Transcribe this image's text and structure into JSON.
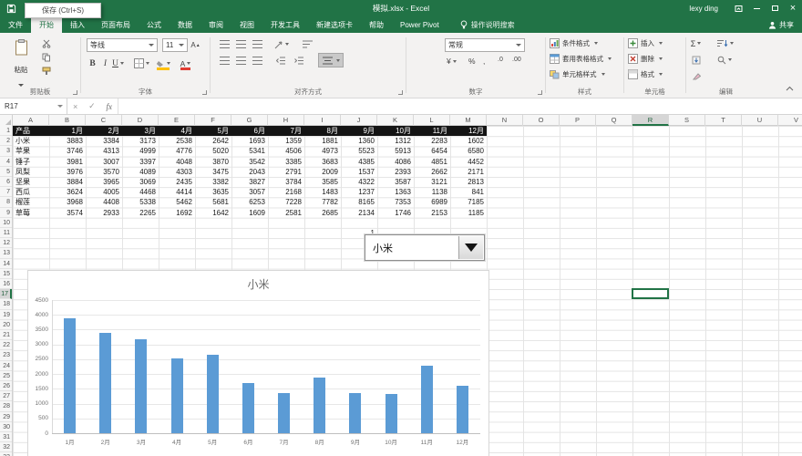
{
  "title_bar": {
    "document_title": "模拟.xlsx - Excel",
    "user_name": "lexy ding",
    "save_tooltip": "保存 (Ctrl+S)"
  },
  "ribbon": {
    "tabs": [
      {
        "id": "file",
        "label": "文件",
        "file": true
      },
      {
        "id": "home",
        "label": "开始",
        "active": true
      },
      {
        "id": "insert",
        "label": "插入"
      },
      {
        "id": "page-layout",
        "label": "页面布局"
      },
      {
        "id": "formulas",
        "label": "公式"
      },
      {
        "id": "data",
        "label": "数据"
      },
      {
        "id": "review",
        "label": "审阅"
      },
      {
        "id": "view",
        "label": "视图"
      },
      {
        "id": "developer",
        "label": "开发工具"
      },
      {
        "id": "new-tab",
        "label": "新建选项卡"
      },
      {
        "id": "help",
        "label": "帮助"
      },
      {
        "id": "power-pivot",
        "label": "Power Pivot"
      }
    ],
    "search_label": "操作说明搜索",
    "share_label": "共享",
    "groups": {
      "clipboard": {
        "label": "剪贴板",
        "paste": "粘贴"
      },
      "font": {
        "label": "字体",
        "family": "等线",
        "size": "11"
      },
      "alignment": {
        "label": "对齐方式"
      },
      "number": {
        "label": "数字",
        "format": "常规"
      },
      "styles": {
        "label": "样式",
        "conditional": "条件格式",
        "format_table": "套用表格格式",
        "cell_styles": "单元格样式"
      },
      "cells": {
        "label": "单元格",
        "insert": "插入",
        "delete": "删除",
        "format": "格式"
      },
      "editing": {
        "label": "编辑"
      }
    }
  },
  "formula_bar": {
    "name_box": "R17",
    "fx_label": "fx"
  },
  "sheet": {
    "columns": [
      "A",
      "B",
      "C",
      "D",
      "E",
      "F",
      "G",
      "H",
      "I",
      "J",
      "K",
      "L",
      "M",
      "N",
      "O",
      "P",
      "Q",
      "R",
      "S",
      "T",
      "U",
      "V"
    ],
    "row_count": 33,
    "selected": {
      "column": "R",
      "row": 17,
      "ref": "R17"
    },
    "table": {
      "header": [
        "产品",
        "1月",
        "2月",
        "3月",
        "4月",
        "5月",
        "6月",
        "7月",
        "8月",
        "9月",
        "10月",
        "11月",
        "12月"
      ],
      "products": [
        {
          "name": "小米",
          "values": [
            3883,
            3384,
            3173,
            2538,
            2642,
            1693,
            1359,
            1881,
            1360,
            1312,
            2283,
            1602
          ]
        },
        {
          "name": "苹果",
          "values": [
            3746,
            4313,
            4999,
            4776,
            5020,
            5341,
            4506,
            4973,
            5523,
            5913,
            6454,
            6580
          ]
        },
        {
          "name": "锤子",
          "values": [
            3981,
            3007,
            3397,
            4048,
            3870,
            3542,
            3385,
            3683,
            4385,
            4086,
            4851,
            4452
          ]
        },
        {
          "name": "凤梨",
          "values": [
            3976,
            3570,
            4089,
            4303,
            3475,
            2043,
            2791,
            2009,
            1537,
            2393,
            2662,
            2171
          ]
        },
        {
          "name": "坚果",
          "values": [
            3884,
            3965,
            3069,
            2435,
            3382,
            3827,
            3784,
            3585,
            4322,
            3587,
            3121,
            2813
          ]
        },
        {
          "name": "西瓜",
          "values": [
            3624,
            4005,
            4468,
            4414,
            3635,
            3057,
            2168,
            1483,
            1237,
            1363,
            1138,
            841
          ]
        },
        {
          "name": "榴莲",
          "values": [
            3968,
            4408,
            5338,
            5462,
            5681,
            6253,
            7228,
            7782,
            8165,
            7353,
            6989,
            7185
          ]
        },
        {
          "name": "草莓",
          "values": [
            3574,
            2933,
            2265,
            1692,
            1642,
            1609,
            2581,
            2685,
            2134,
            1746,
            2153,
            1185
          ]
        }
      ]
    },
    "combo": {
      "selected": "小米"
    },
    "cells": [
      {
        "col": "J",
        "row": 11,
        "value": "1"
      }
    ]
  },
  "chart_data": {
    "type": "bar",
    "title": "小米",
    "categories": [
      "1月",
      "2月",
      "3月",
      "4月",
      "5月",
      "6月",
      "7月",
      "8月",
      "9月",
      "10月",
      "11月",
      "12月"
    ],
    "values": [
      3883,
      3384,
      3173,
      2538,
      2642,
      1693,
      1359,
      1881,
      1360,
      1312,
      2283,
      1602
    ],
    "ylim": [
      0,
      4500
    ],
    "ytick_step": 500,
    "bar_color": "#5B9BD5",
    "grid": true,
    "legend": "none"
  }
}
